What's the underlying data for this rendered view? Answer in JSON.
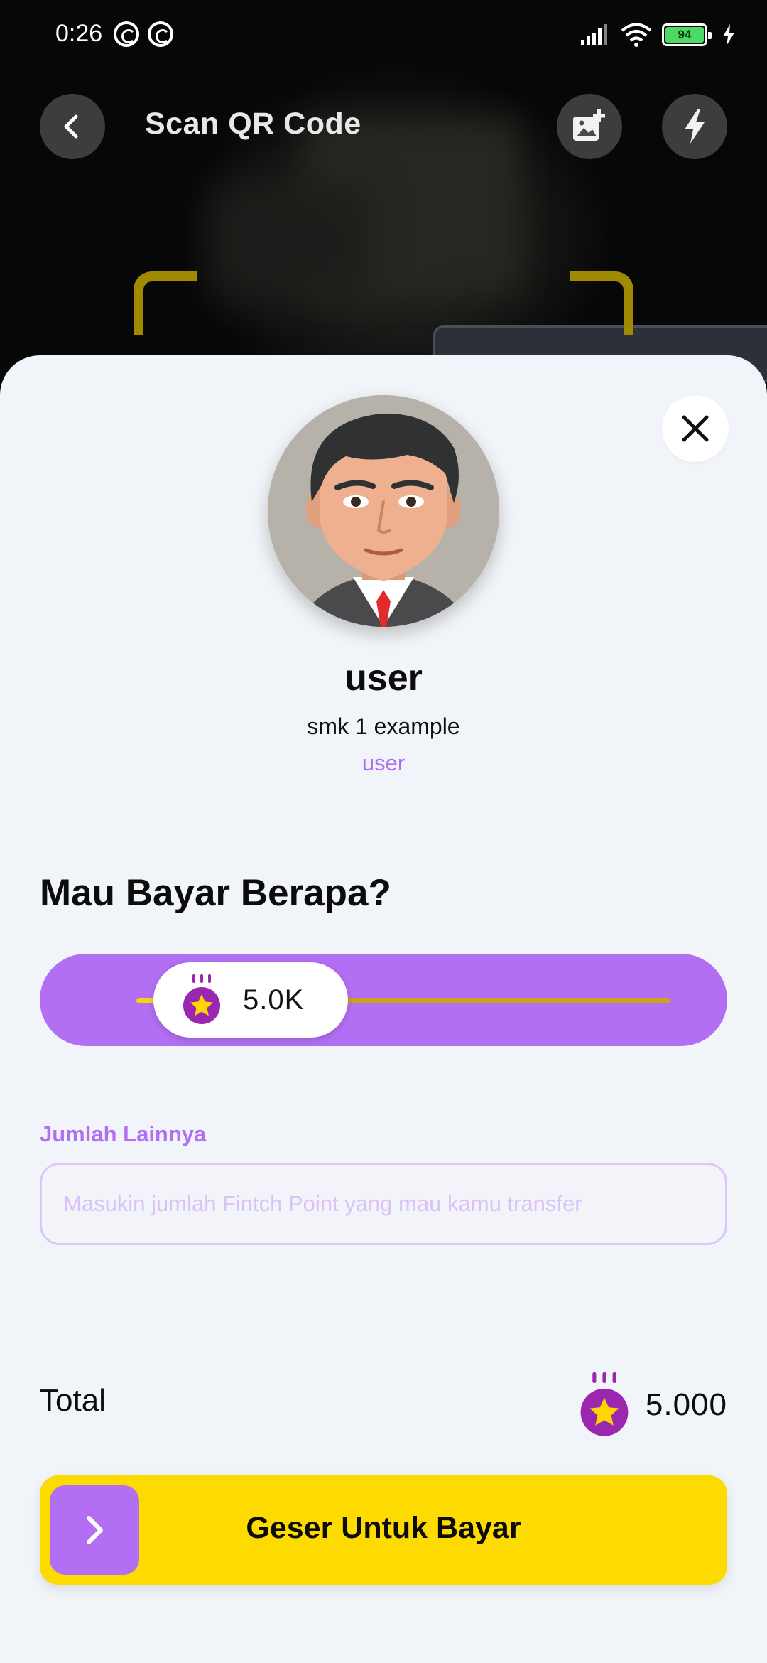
{
  "status_bar": {
    "time": "0:26",
    "battery_level": "94"
  },
  "app_bar": {
    "title": "Scan QR Code",
    "icons": [
      "back-arrow-icon",
      "add-image-icon",
      "flash-icon"
    ]
  },
  "recipient": {
    "name": "user",
    "school": "smk 1 example",
    "role": "user"
  },
  "amount_section": {
    "title": "Mau Bayar Berapa?",
    "slider_value": "5.0K",
    "other_amount_label": "Jumlah Lainnya",
    "input_placeholder": "Masukin jumlah Fintch Point yang mau kamu transfer",
    "input_value": ""
  },
  "total": {
    "label": "Total",
    "value": "5.000"
  },
  "pay_button": {
    "label": "Geser Untuk Bayar"
  },
  "colors": {
    "accent_purple": "#b36ff3",
    "pay_yellow": "#fedb00",
    "coin_purple": "#9b27b0",
    "coin_star": "#ffd600",
    "sheet_background": "#f1f4f8"
  }
}
